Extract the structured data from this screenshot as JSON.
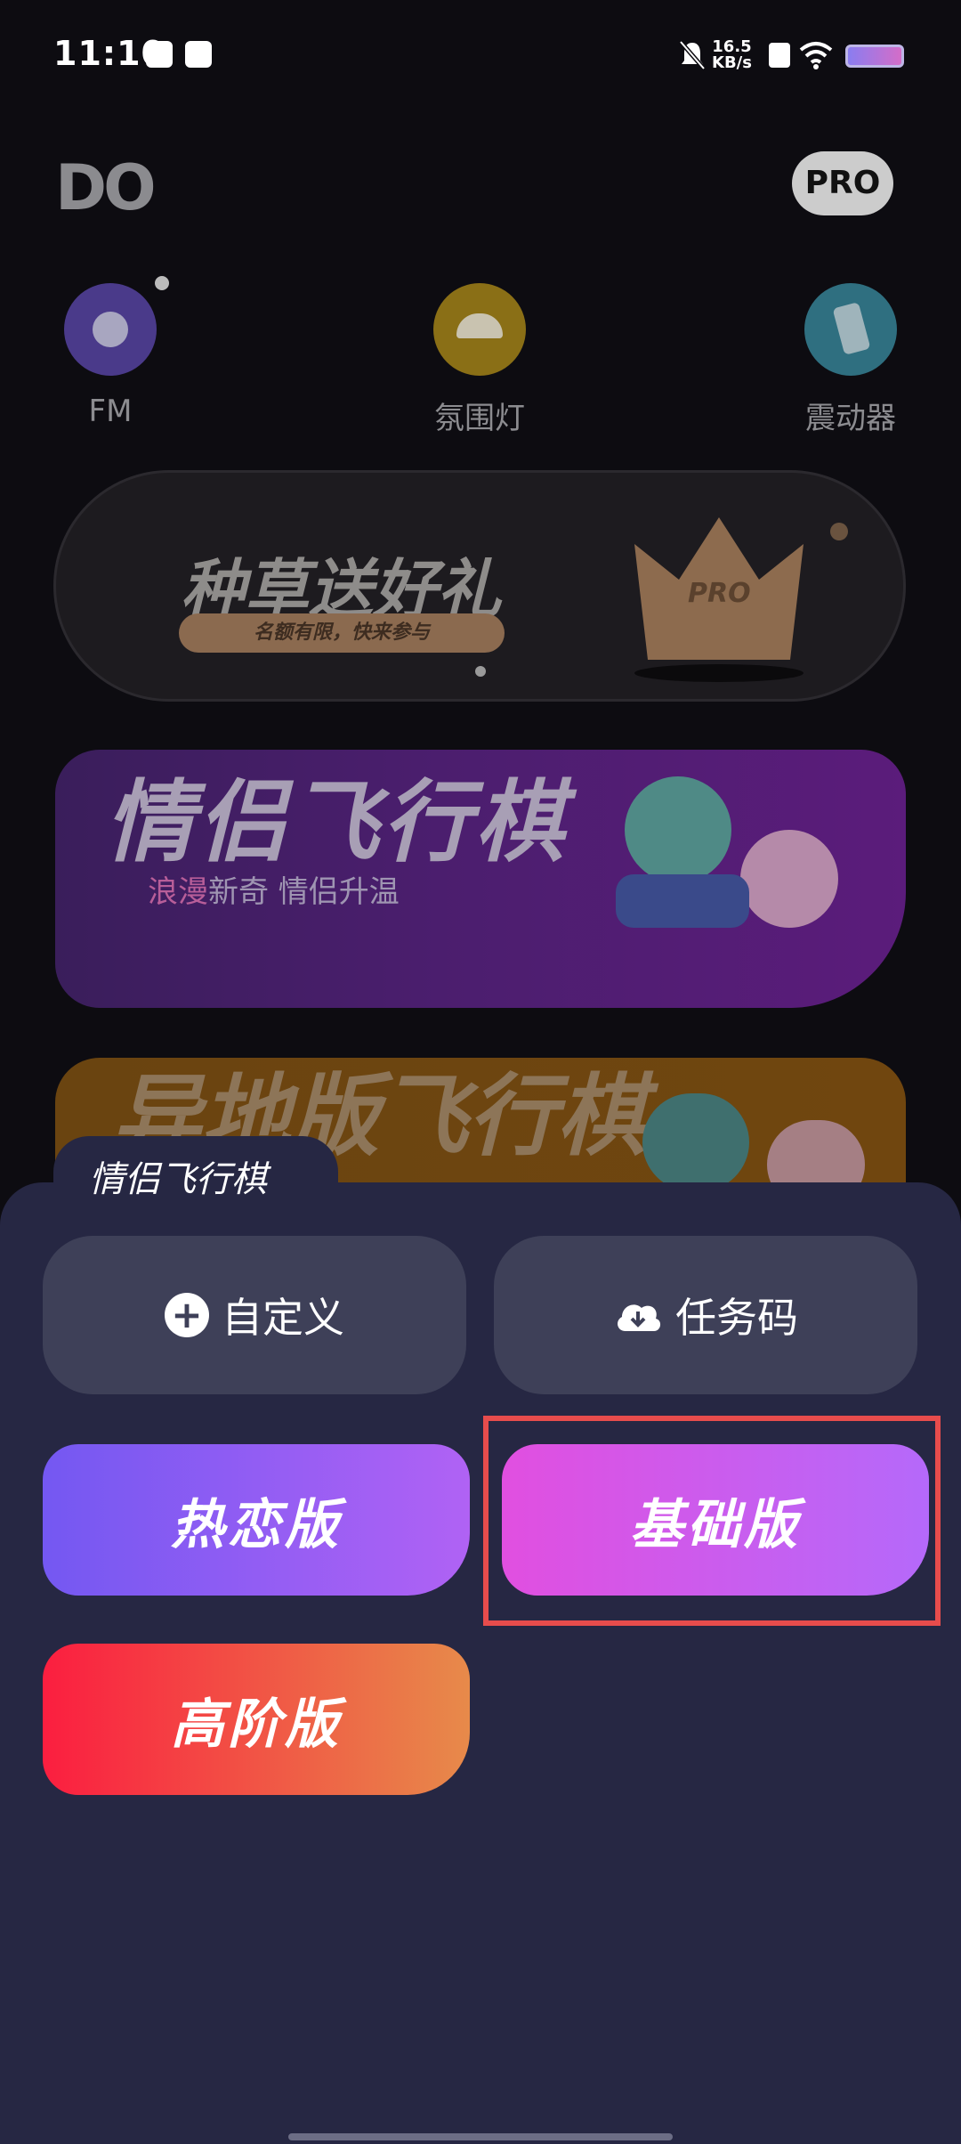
{
  "status_bar": {
    "time": "11:10",
    "net_speed_value": "16.5",
    "net_speed_unit": "KB/s"
  },
  "header": {
    "logo_text": "DO",
    "pro_label": "PRO"
  },
  "tools": [
    {
      "label": "FM",
      "icon": "record-player-icon",
      "color": "#4a3a8a"
    },
    {
      "label": "氛围灯",
      "icon": "lamp-icon",
      "color": "#8a6f16"
    },
    {
      "label": "震动器",
      "icon": "vibrating-phone-icon",
      "color": "#2f6f80"
    }
  ],
  "promo_banner": {
    "title": "种草送好礼",
    "pill": "名额有限，快来参与",
    "crown_label": "PRO"
  },
  "game_card_1": {
    "title": "情侣飞行棋",
    "subtitle_highlight": "浪漫",
    "subtitle_rest": "新奇 情侣升温"
  },
  "game_card_2": {
    "title": "异地版飞行棋"
  },
  "sheet": {
    "title": "情侣飞行棋",
    "custom_label": "自定义",
    "task_code_label": "任务码",
    "modes": [
      {
        "label": "热恋版",
        "gradient": [
          "#7458f2",
          "#b062f4"
        ]
      },
      {
        "label": "基础版",
        "gradient": [
          "#e14fe0",
          "#b569fa"
        ]
      },
      {
        "label": "高阶版",
        "gradient": [
          "#fb1e40",
          "#e78a4a"
        ]
      }
    ]
  },
  "colors": {
    "highlight_border": "#e74c4c",
    "sheet_bg": "#262743"
  }
}
